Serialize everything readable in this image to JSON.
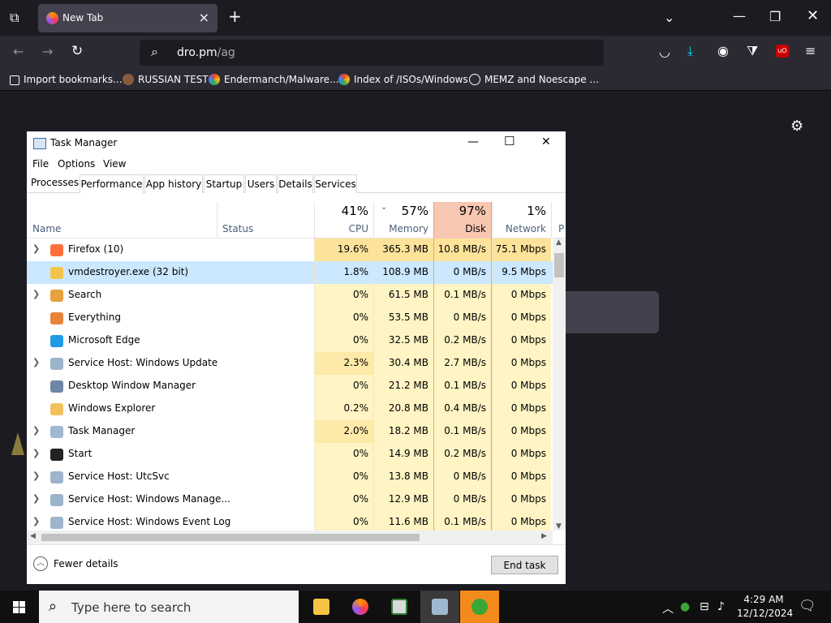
{
  "browser": {
    "tab_title": "New Tab",
    "url_host": "dro.pm",
    "url_path": "/ag",
    "bookmarks": [
      {
        "label": "Import bookmarks..."
      },
      {
        "label": "RUSSIAN TEST"
      },
      {
        "label": "Endermanch/Malware..."
      },
      {
        "label": "Index of /ISOs/Windows"
      },
      {
        "label": "MEMZ and Noescape ..."
      }
    ]
  },
  "task_manager": {
    "title": "Task Manager",
    "menu": [
      "File",
      "Options",
      "View"
    ],
    "tabs": [
      "Processes",
      "Performance",
      "App history",
      "Startup",
      "Users",
      "Details",
      "Services"
    ],
    "columns": {
      "name": "Name",
      "status": "Status",
      "cpu": {
        "pct": "41%",
        "label": "CPU"
      },
      "memory": {
        "pct": "57%",
        "label": "Memory"
      },
      "disk": {
        "pct": "97%",
        "label": "Disk"
      },
      "network": {
        "pct": "1%",
        "label": "Network"
      },
      "power": "P"
    },
    "processes": [
      {
        "name": "Firefox (10)",
        "expandable": true,
        "cpu": "19.6%",
        "memory": "365.3 MB",
        "disk": "10.8 MB/s",
        "network": "75.1 Mbps"
      },
      {
        "name": "vmdestroyer.exe (32 bit)",
        "expandable": false,
        "cpu": "1.8%",
        "memory": "108.9 MB",
        "disk": "0 MB/s",
        "network": "9.5 Mbps"
      },
      {
        "name": "Search",
        "expandable": true,
        "cpu": "0%",
        "memory": "61.5 MB",
        "disk": "0.1 MB/s",
        "network": "0 Mbps"
      },
      {
        "name": "Everything",
        "expandable": false,
        "cpu": "0%",
        "memory": "53.5 MB",
        "disk": "0 MB/s",
        "network": "0 Mbps"
      },
      {
        "name": "Microsoft Edge",
        "expandable": false,
        "cpu": "0%",
        "memory": "32.5 MB",
        "disk": "0.2 MB/s",
        "network": "0 Mbps"
      },
      {
        "name": "Service Host: Windows Update",
        "expandable": true,
        "cpu": "2.3%",
        "memory": "30.4 MB",
        "disk": "2.7 MB/s",
        "network": "0 Mbps"
      },
      {
        "name": "Desktop Window Manager",
        "expandable": false,
        "cpu": "0%",
        "memory": "21.2 MB",
        "disk": "0.1 MB/s",
        "network": "0 Mbps"
      },
      {
        "name": "Windows Explorer",
        "expandable": false,
        "cpu": "0.2%",
        "memory": "20.8 MB",
        "disk": "0.4 MB/s",
        "network": "0 Mbps"
      },
      {
        "name": "Task Manager",
        "expandable": true,
        "cpu": "2.0%",
        "memory": "18.2 MB",
        "disk": "0.1 MB/s",
        "network": "0 Mbps"
      },
      {
        "name": "Start",
        "expandable": true,
        "cpu": "0%",
        "memory": "14.9 MB",
        "disk": "0.2 MB/s",
        "network": "0 Mbps"
      },
      {
        "name": "Service Host: UtcSvc",
        "expandable": true,
        "cpu": "0%",
        "memory": "13.8 MB",
        "disk": "0 MB/s",
        "network": "0 Mbps"
      },
      {
        "name": "Service Host: Windows Manage...",
        "expandable": true,
        "cpu": "0%",
        "memory": "12.9 MB",
        "disk": "0 MB/s",
        "network": "0 Mbps"
      },
      {
        "name": "Service Host: Windows Event Log",
        "expandable": true,
        "cpu": "0%",
        "memory": "11.6 MB",
        "disk": "0.1 MB/s",
        "network": "0 Mbps"
      }
    ],
    "fewer_details": "Fewer details",
    "end_task": "End task"
  },
  "taskbar": {
    "search_placeholder": "Type here to search",
    "time": "4:29 AM",
    "date": "12/12/2024"
  },
  "colors": {
    "cpu_hot": "#fde39a",
    "row_light": "#fff4c4",
    "disk_header": "#f8c7b2",
    "selected_row": "#cce8ff",
    "browser_bg": "#1c1b22"
  }
}
